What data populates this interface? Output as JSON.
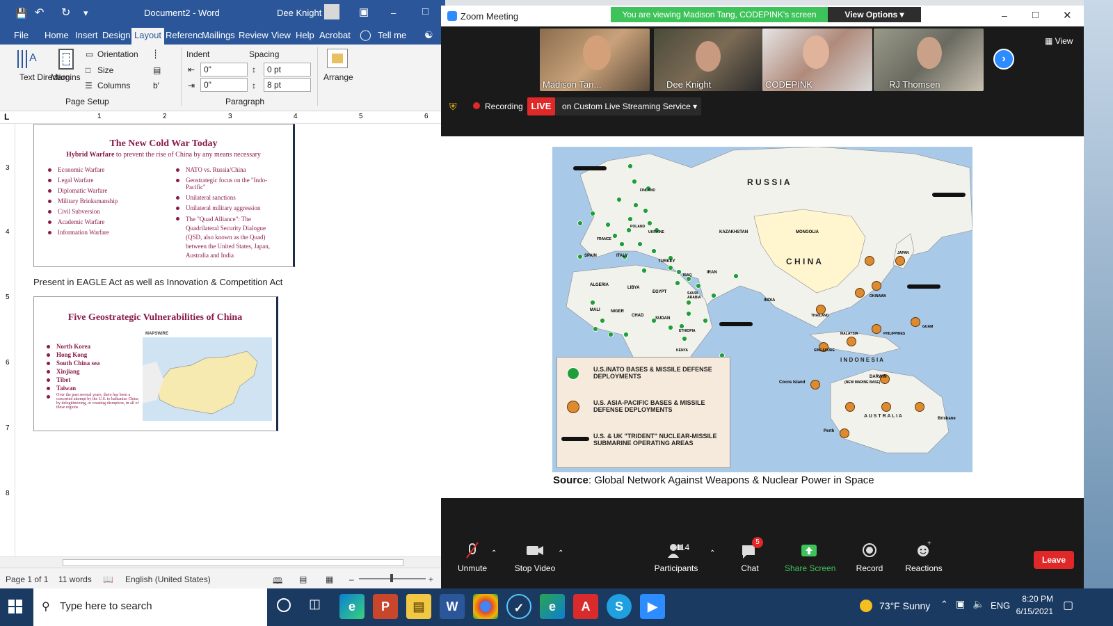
{
  "word": {
    "title": "Document2 - Word",
    "user": "Dee Knight",
    "menu": [
      "File",
      "Home",
      "Insert",
      "Design",
      "Layout",
      "Referenc",
      "Mailings",
      "Review",
      "View",
      "Help",
      "Acrobat",
      "Tell me"
    ],
    "active_tab": "Layout",
    "ribbon": {
      "text_direction": "Text Direction",
      "margins": "Margins",
      "orientation": "Orientation",
      "size": "Size",
      "columns": "Columns",
      "page_setup": "Page Setup",
      "indent": "Indent",
      "spacing": "Spacing",
      "indent_left": "0\"",
      "indent_right": "0\"",
      "spacing_before": "0 pt",
      "spacing_after": "8 pt",
      "paragraph": "Paragraph",
      "arrange": "Arrange"
    },
    "ruler_numbers": [
      "1",
      "2",
      "3",
      "4",
      "5",
      "6"
    ],
    "vruler_numbers": [
      "3",
      "4",
      "5",
      "6",
      "7",
      "8"
    ],
    "slide1": {
      "title": "The New Cold War Today",
      "subtitle_bold": "Hybrid Warfare",
      "subtitle_rest": " to prevent the rise of China by any means necessary",
      "left": [
        "Economic Warfare",
        "Legal Warfare",
        "Diplomatic Warfare",
        "Military Brinksmanship",
        "Civil Subversion",
        "Academic Warfare",
        "Information Warfare"
      ],
      "right": [
        "NATO vs. Russia/China",
        "Geostrategic focus on the \"Indo-Pacific\"",
        "Unilateral sanctions",
        "Unilateral military aggression",
        "The \"Quad Alliance\": The Quadrilateral Security Dialogue (QSD, also known as the Quad) between the United States, Japan, Australia and India"
      ]
    },
    "body_text": "Present in EAGLE Act as well as Innovation & Competition Act",
    "slide2": {
      "title": "Five Geostrategic Vulnerabilities of China",
      "logo": "MAPSWIRE",
      "items": [
        "North Korea",
        "Hong Kong",
        "South China sea",
        "Xinjiang",
        "Tibet",
        "Taiwan"
      ],
      "note": "Over the past several years, there has been a concerted attempt by the U.S. to balkanize China by delegitimizing, or creating disruption, in all of these regions"
    },
    "status": {
      "page": "Page 1 of 1",
      "words": "11 words",
      "language": "English (United States)"
    }
  },
  "zoom": {
    "title": "Zoom Meeting",
    "viewing": "You are viewing Madison Tang, CODEPINK's screen",
    "view_options": "View Options",
    "view": "View",
    "participants_thumbs": [
      {
        "name": "Madison Tan..."
      },
      {
        "name": "Dee Knight"
      },
      {
        "name": "CODEPINK"
      },
      {
        "name": "RJ Thomsen"
      }
    ],
    "recording": "Recording",
    "live": "LIVE",
    "streaming": "on Custom Live Streaming Service",
    "map": {
      "russia": "R U S S I A",
      "china": "C H I N A",
      "australia": "A U S T R A L I A",
      "indonesia": "I N D O N E S I A",
      "countries": [
        "KAZAKHSTAN",
        "MONGOLIA",
        "INDIA",
        "IRAN",
        "ALGERIA",
        "LIBYA",
        "EGYPT",
        "SAUDI ARABIA",
        "NIGER",
        "CHAD",
        "SUDAN",
        "MALI",
        "SPAIN",
        "ITALY",
        "TURKEY",
        "FRANCE",
        "POLAND",
        "UKRAINE",
        "IRAQ",
        "ETHIOPIA",
        "KENYA",
        "JAPAN",
        "PHILIPPINES",
        "MALAYSIA",
        "SINGAPORE",
        "THAILAND",
        "OKINAWA",
        "GUAM",
        "FINLAND"
      ],
      "cities": [
        "Cocos Island",
        "DARWIN",
        "(NEW MARINE BASE)",
        "Perth",
        "Brisbane"
      ],
      "legend": {
        "green": "U.S./NATO BASES & MISSILE DEFENSE DEPLOYMENTS",
        "orange": "U.S. ASIA-PACIFIC BASES & MISSILE DEFENSE DEPLOYMENTS",
        "sub": "U.S. & UK \"TRIDENT\" NUCLEAR-MISSILE SUBMARINE OPERATING AREAS"
      },
      "source_label": "Source",
      "source_text": ": Global Network Against Weapons & Nuclear Power in Space",
      "colors": {
        "green": "#1f9e3a",
        "orange": "#e08a30",
        "ocean": "#a9c9e8",
        "land": "#f2f2ec",
        "china": "#fff6d0"
      }
    },
    "toolbar": {
      "unmute": "Unmute",
      "stop_video": "Stop Video",
      "participants": "Participants",
      "participants_count": "114",
      "chat": "Chat",
      "chat_badge": "5",
      "share": "Share Screen",
      "record": "Record",
      "reactions": "Reactions",
      "leave": "Leave"
    }
  },
  "taskbar": {
    "search": "Type here to search",
    "weather": "73°F  Sunny",
    "lang": "ENG",
    "time": "8:20 PM",
    "date": "6/15/2021"
  }
}
